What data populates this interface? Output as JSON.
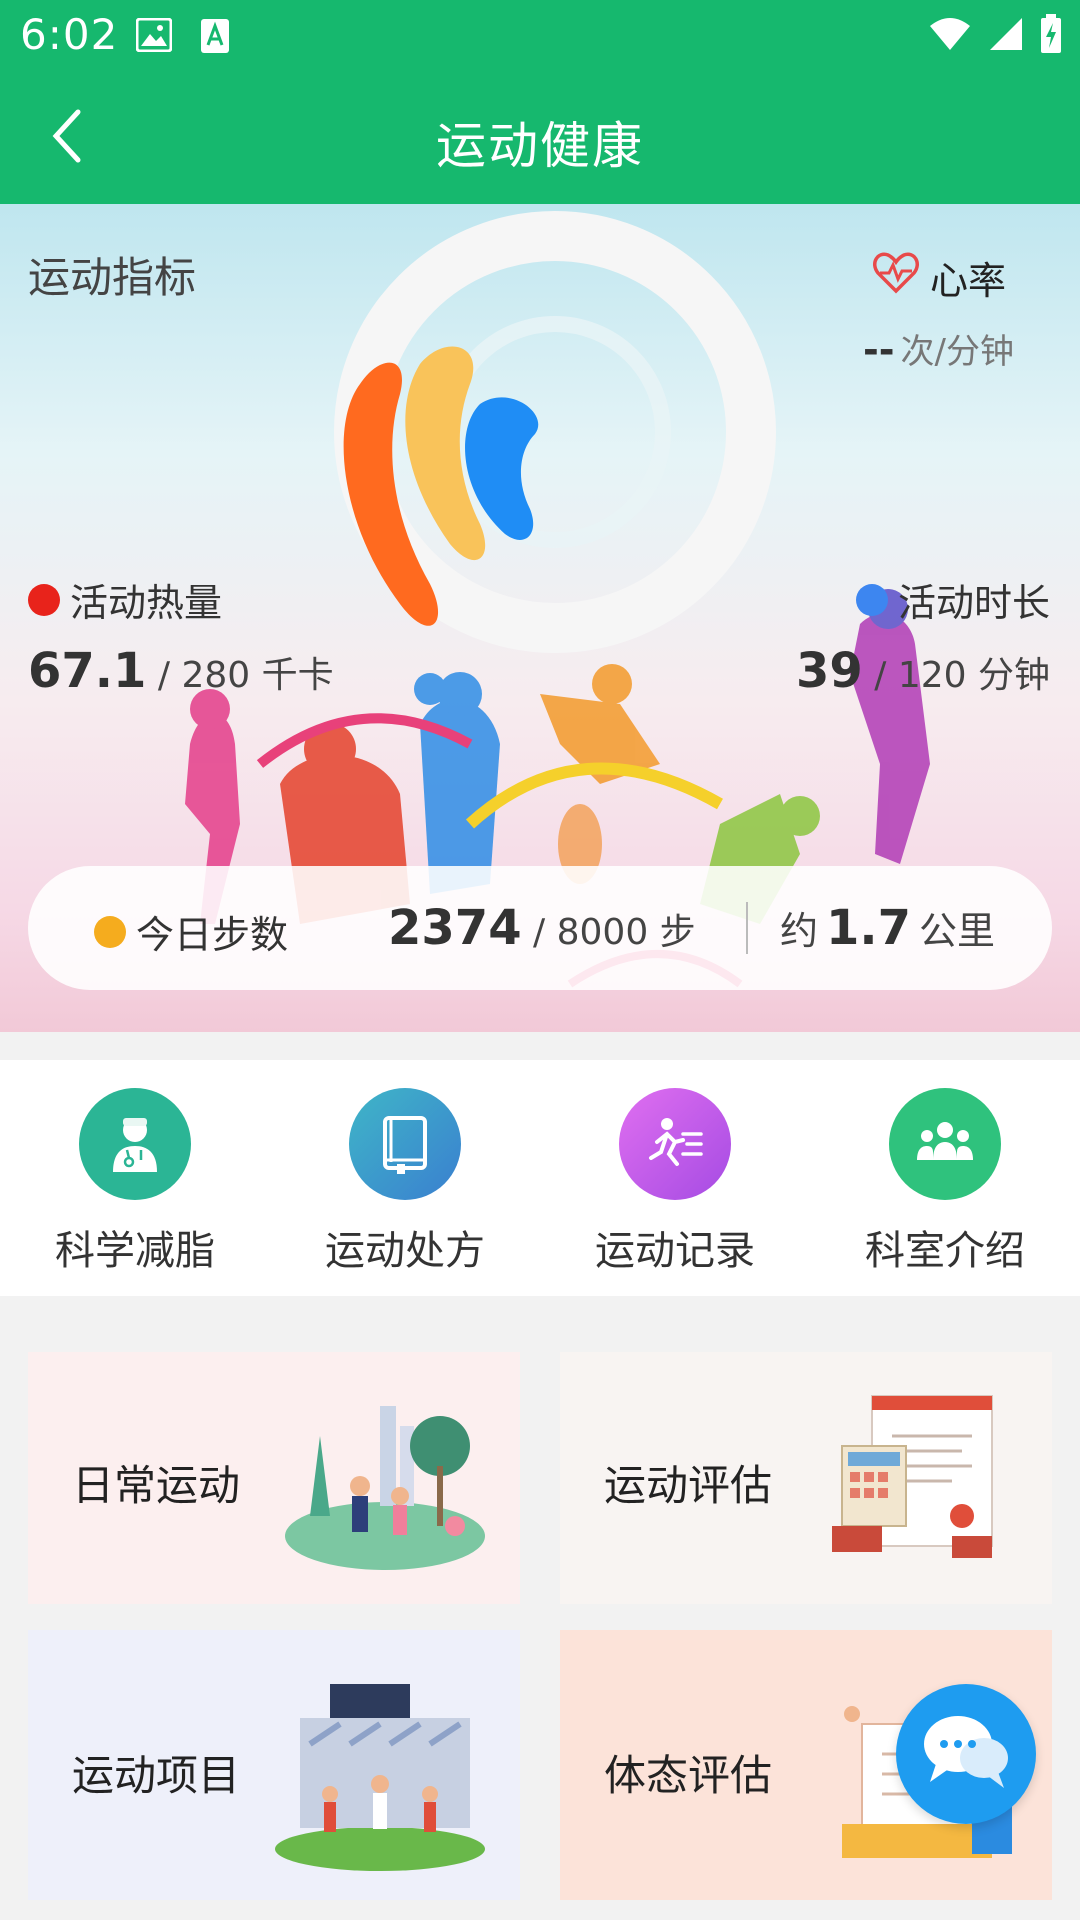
{
  "status_bar": {
    "time": "6:02"
  },
  "app_bar": {
    "title": "运动健康"
  },
  "hero": {
    "title": "运动指标",
    "heart_rate": {
      "label": "心率",
      "value": "--",
      "unit": "次/分钟"
    },
    "calories": {
      "label": "活动热量",
      "value": "67.1",
      "goal_text": "/ 280 千卡",
      "dot_color": "#e8231b"
    },
    "duration": {
      "label": "活动时长",
      "value": "39",
      "goal_text": "/ 120 分钟",
      "dot_color": "#3d86f0"
    },
    "steps": {
      "label": "今日步数",
      "value": "2374",
      "goal_text": "/ 8000 步",
      "distance_prefix": "约",
      "distance_value": "1.7",
      "distance_unit": "公里",
      "dot_color": "#f5ac1e"
    }
  },
  "quick_menu": [
    {
      "label": "科学减脂",
      "icon": "doctor-icon",
      "color": "#2bb595"
    },
    {
      "label": "运动处方",
      "icon": "book-icon",
      "color": "#3a9fc9"
    },
    {
      "label": "运动记录",
      "icon": "runner-icon",
      "color": "#c75ee8"
    },
    {
      "label": "科室介绍",
      "icon": "group-icon",
      "color": "#2fc27d"
    }
  ],
  "tiles": [
    {
      "label": "日常运动",
      "bg": "#fcefef"
    },
    {
      "label": "运动评估",
      "bg": "#f8f4f2"
    },
    {
      "label": "运动项目",
      "bg": "#eef0fa"
    },
    {
      "label": "体态评估",
      "bg": "#fce3d9"
    }
  ],
  "colors": {
    "brand": "#16b86e"
  }
}
